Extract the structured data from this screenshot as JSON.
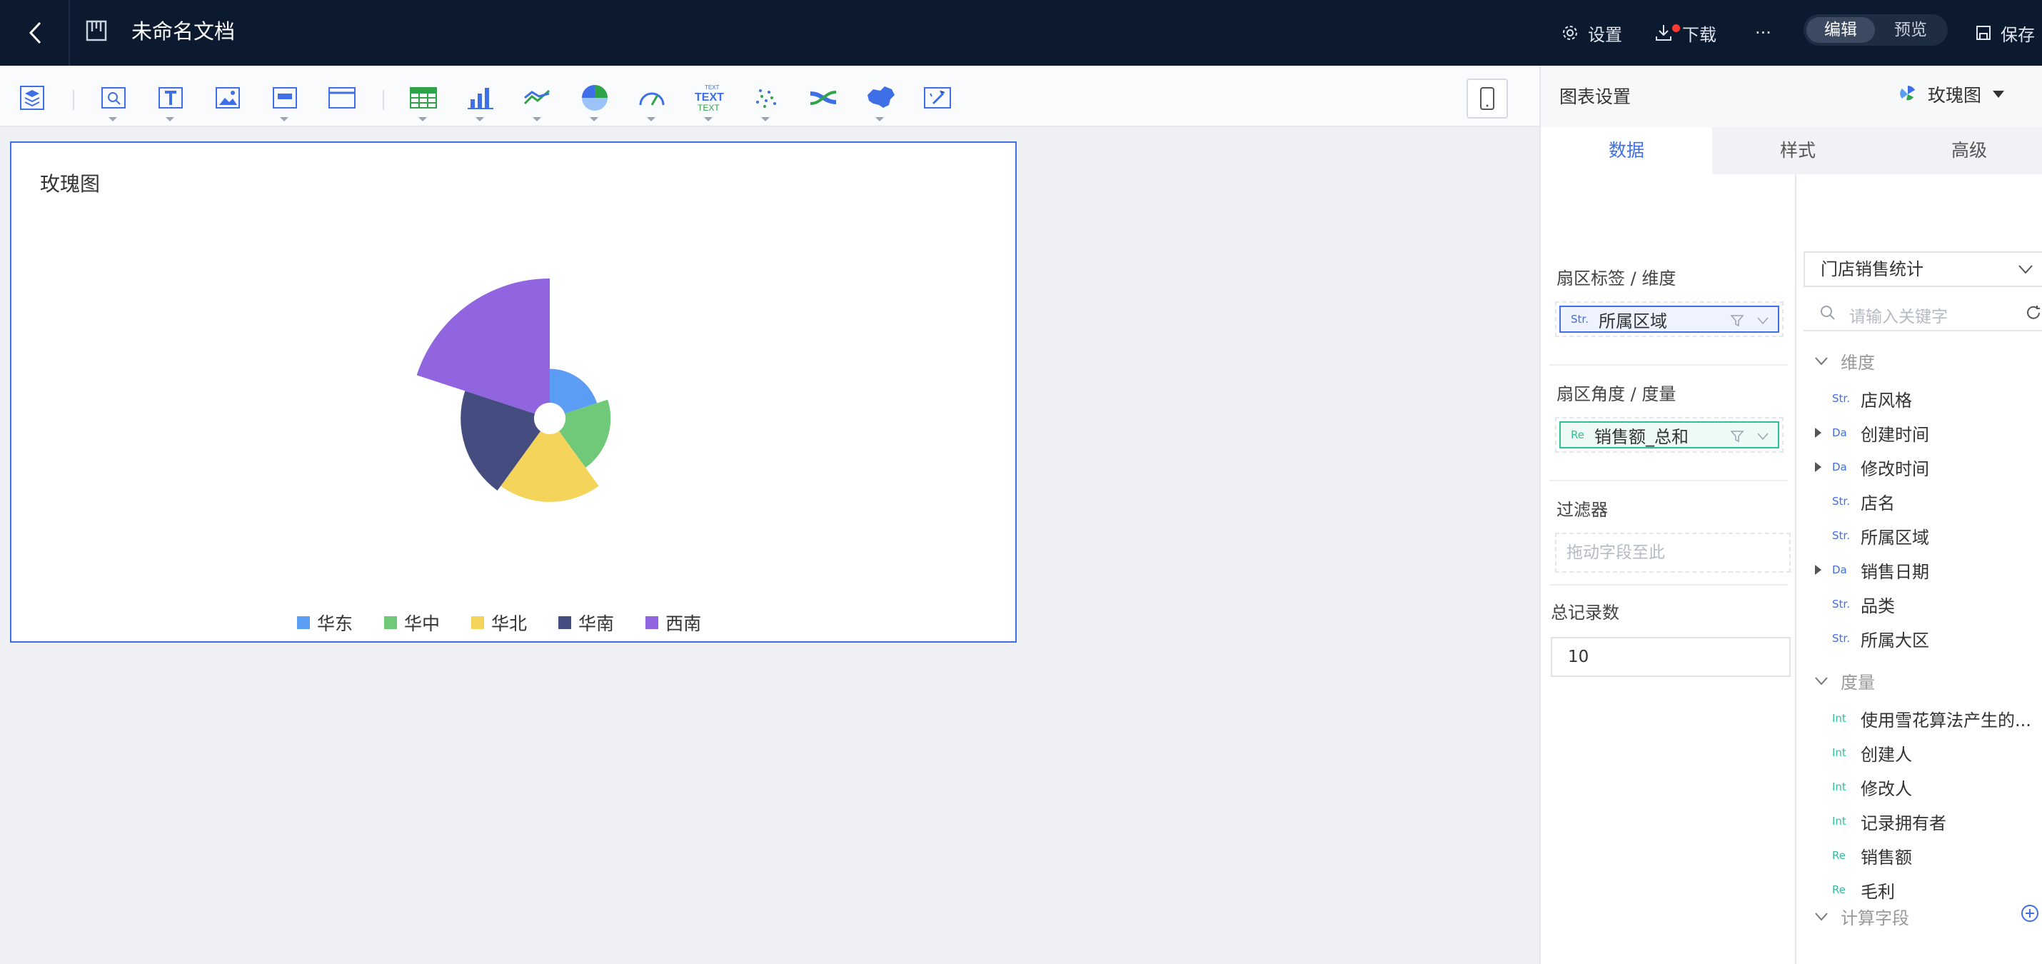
{
  "topbar": {
    "doc_title": "未命名文档",
    "settings_label": "设置",
    "download_label": "下载",
    "more_label": "···",
    "mode_edit": "编辑",
    "mode_preview": "预览",
    "save_label": "保存"
  },
  "chart": {
    "title": "玫瑰图"
  },
  "chart_data": {
    "type": "pie",
    "variant": "rose",
    "title": "玫瑰图",
    "categories": [
      "华东",
      "华中",
      "华北",
      "华南",
      "西南"
    ],
    "values": [
      60,
      80,
      120,
      130,
      220
    ],
    "colors": [
      "#5b9cf4",
      "#6fc979",
      "#f5d45c",
      "#454d80",
      "#9265e0"
    ],
    "legend_position": "bottom"
  },
  "panel": {
    "title": "图表设置",
    "chart_type_label": "玫瑰图",
    "tabs": [
      "数据",
      "样式",
      "高级"
    ],
    "dimension_title": "扇区标签 / 维度",
    "dimension_field": {
      "tag": "Str.",
      "label": "所属区域"
    },
    "measure_title": "扇区角度 / 度量",
    "measure_field": {
      "tag": "Re",
      "label": "销售额_总和"
    },
    "filter_title": "过滤器",
    "filter_placeholder": "拖动字段至此",
    "count_title": "总记录数",
    "count_value": "10",
    "dataset": "门店销售统计",
    "search_placeholder": "请输入关键字",
    "dim_group": "维度",
    "dims": [
      {
        "tag": "Str.",
        "label": "店风格"
      },
      {
        "tag": "Da",
        "label": "创建时间"
      },
      {
        "tag": "Da",
        "label": "修改时间"
      },
      {
        "tag": "Str.",
        "label": "店名"
      },
      {
        "tag": "Str.",
        "label": "所属区域"
      },
      {
        "tag": "Da",
        "label": "销售日期"
      },
      {
        "tag": "Str.",
        "label": "品类"
      },
      {
        "tag": "Str.",
        "label": "所属大区"
      }
    ],
    "measure_group": "度量",
    "measures": [
      {
        "tag": "Int",
        "label": "使用雪花算法产生的..."
      },
      {
        "tag": "Int",
        "label": "创建人"
      },
      {
        "tag": "Int",
        "label": "修改人"
      },
      {
        "tag": "Int",
        "label": "记录拥有者"
      },
      {
        "tag": "Re",
        "label": "销售额"
      },
      {
        "tag": "Re",
        "label": "毛利"
      }
    ],
    "calc_group": "计算字段"
  }
}
